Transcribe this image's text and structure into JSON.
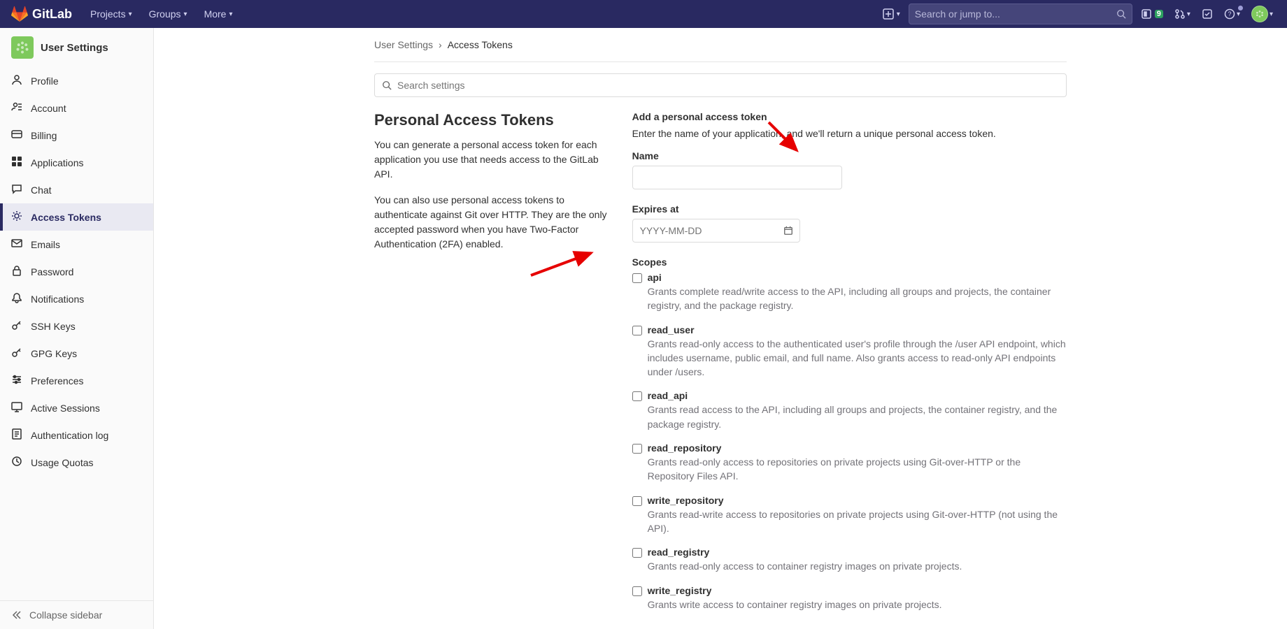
{
  "topbar": {
    "brand": "GitLab",
    "nav": [
      "Projects",
      "Groups",
      "More"
    ],
    "search_placeholder": "Search or jump to...",
    "issues_badge": "9"
  },
  "sidebar": {
    "title": "User Settings",
    "items": [
      {
        "label": "Profile",
        "icon": "user"
      },
      {
        "label": "Account",
        "icon": "account"
      },
      {
        "label": "Billing",
        "icon": "card"
      },
      {
        "label": "Applications",
        "icon": "apps"
      },
      {
        "label": "Chat",
        "icon": "chat"
      },
      {
        "label": "Access Tokens",
        "icon": "token",
        "active": true
      },
      {
        "label": "Emails",
        "icon": "mail"
      },
      {
        "label": "Password",
        "icon": "lock"
      },
      {
        "label": "Notifications",
        "icon": "bell"
      },
      {
        "label": "SSH Keys",
        "icon": "key"
      },
      {
        "label": "GPG Keys",
        "icon": "key"
      },
      {
        "label": "Preferences",
        "icon": "prefs"
      },
      {
        "label": "Active Sessions",
        "icon": "sessions"
      },
      {
        "label": "Authentication log",
        "icon": "log"
      },
      {
        "label": "Usage Quotas",
        "icon": "quota"
      }
    ],
    "collapse": "Collapse sidebar"
  },
  "breadcrumb": {
    "parent": "User Settings",
    "current": "Access Tokens"
  },
  "search_settings_placeholder": "Search settings",
  "page": {
    "title": "Personal Access Tokens",
    "desc1": "You can generate a personal access token for each application you use that needs access to the GitLab API.",
    "desc2": "You can also use personal access tokens to authenticate against Git over HTTP. They are the only accepted password when you have Two-Factor Authentication (2FA) enabled."
  },
  "form": {
    "heading": "Add a personal access token",
    "sub": "Enter the name of your application, and we'll return a unique personal access token.",
    "name_label": "Name",
    "expires_label": "Expires at",
    "expires_placeholder": "YYYY-MM-DD",
    "scopes_label": "Scopes",
    "scopes": [
      {
        "name": "api",
        "desc": "Grants complete read/write access to the API, including all groups and projects, the container registry, and the package registry."
      },
      {
        "name": "read_user",
        "desc": "Grants read-only access to the authenticated user's profile through the /user API endpoint, which includes username, public email, and full name. Also grants access to read-only API endpoints under /users."
      },
      {
        "name": "read_api",
        "desc": "Grants read access to the API, including all groups and projects, the container registry, and the package registry."
      },
      {
        "name": "read_repository",
        "desc": "Grants read-only access to repositories on private projects using Git-over-HTTP or the Repository Files API."
      },
      {
        "name": "write_repository",
        "desc": "Grants read-write access to repositories on private projects using Git-over-HTTP (not using the API)."
      },
      {
        "name": "read_registry",
        "desc": "Grants read-only access to container registry images on private projects."
      },
      {
        "name": "write_registry",
        "desc": "Grants write access to container registry images on private projects."
      }
    ]
  }
}
